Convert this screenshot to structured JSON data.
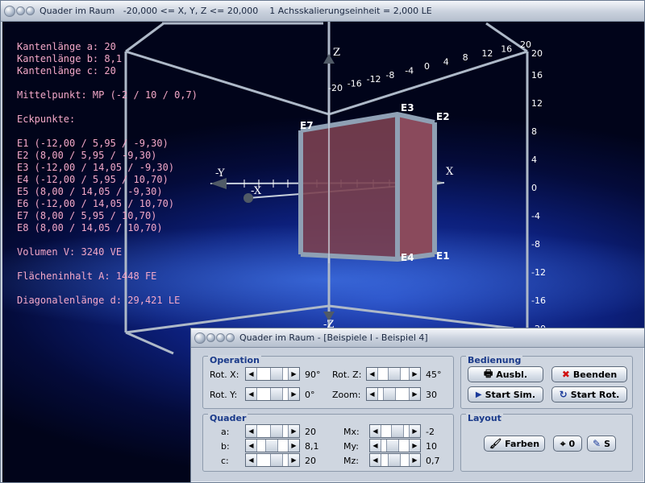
{
  "main_window": {
    "title": "Quader im Raum   -20,000 <= X, Y, Z <= 20,000    1 Achsskalierungseinheit = 2,000 LE"
  },
  "info": {
    "edge_a": "Kantenlänge a: 20",
    "edge_b": "Kantenlänge b: 8,1",
    "edge_c": "Kantenlänge c: 20",
    "midpoint": "Mittelpunkt: MP (-2 / 10 / 0,7)",
    "corners_heading": "Eckpunkte:",
    "corners": [
      "E1 (-12,00 / 5,95 / -9,30)",
      "E2 (8,00 / 5,95 / -9,30)",
      "E3 (-12,00 / 14,05 / -9,30)",
      "E4 (-12,00 / 5,95 / 10,70)",
      "E5 (8,00 / 14,05 / -9,30)",
      "E6 (-12,00 / 14,05 / 10,70)",
      "E7 (8,00 / 5,95 / 10,70)",
      "E8 (8,00 / 14,05 / 10,70)"
    ],
    "volume": "Volumen V: 3240 VE",
    "area": "Flächeninhalt A: 1448 FE",
    "diagonal": "Diagonalenlänge d: 29,421 LE"
  },
  "scene": {
    "axis_labels": {
      "x": "X",
      "y": "-Y",
      "z": "Z",
      "neg_x": "-X",
      "neg_z": "-Z"
    },
    "vertical_scale": [
      "20",
      "16",
      "12",
      "8",
      "4",
      "0",
      "-4",
      "-8",
      "-12",
      "-16",
      "-20"
    ],
    "y_scale": [
      "-20",
      "-16",
      "-12",
      "-8",
      "-4",
      "0",
      "4",
      "8",
      "12",
      "16",
      "20"
    ],
    "corner_labels": {
      "e1": "E1",
      "e2": "E2",
      "e3": "E3",
      "e4": "E4",
      "e7": "E7"
    },
    "colors": {
      "box_face": "#7a4050",
      "box_edge": "#8fa0b4",
      "frame": "#aeb9c8",
      "info_text": "#f4a8c8"
    }
  },
  "dialog": {
    "title": "Quader im Raum - [Beispiele I - Beispiel 4]",
    "operation": {
      "title": "Operation",
      "rot_x_label": "Rot. X:",
      "rot_x_value": "90°",
      "rot_y_label": "Rot. Y:",
      "rot_y_value": "0°",
      "rot_z_label": "Rot. Z:",
      "rot_z_value": "45°",
      "zoom_label": "Zoom:",
      "zoom_value": "30"
    },
    "bedienung": {
      "title": "Bedienung",
      "ausbl": "Ausbl.",
      "beenden": "Beenden",
      "start_sim": "Start Sim.",
      "start_rot": "Start Rot."
    },
    "quader": {
      "title": "Quader",
      "a_label": "a:",
      "a_value": "20",
      "b_label": "b:",
      "b_value": "8,1",
      "c_label": "c:",
      "c_value": "20",
      "mx_label": "Mx:",
      "mx_value": "-2",
      "my_label": "My:",
      "my_value": "10",
      "mz_label": "Mz:",
      "mz_value": "0,7"
    },
    "layout": {
      "title": "Layout",
      "farben": "Farben",
      "zero": "0",
      "s": "S"
    }
  }
}
